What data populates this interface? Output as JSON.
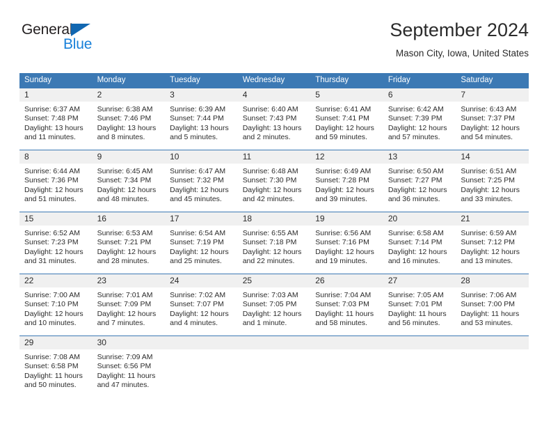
{
  "brand": {
    "name_top": "General",
    "name_bottom": "Blue",
    "triangle_color": "#1167b1",
    "blue_text_color": "#1880d9"
  },
  "header": {
    "title": "September 2024",
    "subtitle": "Mason City, Iowa, United States"
  },
  "theme": {
    "header_blue": "#3c79b4",
    "daynum_band": "#f0f0f0",
    "text": "#2b2b2b"
  },
  "calendar": {
    "weekday_headers": [
      "Sunday",
      "Monday",
      "Tuesday",
      "Wednesday",
      "Thursday",
      "Friday",
      "Saturday"
    ],
    "labels": {
      "sunrise": "Sunrise:",
      "sunset": "Sunset:",
      "daylight": "Daylight:"
    },
    "weeks": [
      [
        {
          "day": "1",
          "sunrise": "Sunrise: 6:37 AM",
          "sunset": "Sunset: 7:48 PM",
          "daylight_1": "Daylight: 13 hours",
          "daylight_2": "and 11 minutes."
        },
        {
          "day": "2",
          "sunrise": "Sunrise: 6:38 AM",
          "sunset": "Sunset: 7:46 PM",
          "daylight_1": "Daylight: 13 hours",
          "daylight_2": "and 8 minutes."
        },
        {
          "day": "3",
          "sunrise": "Sunrise: 6:39 AM",
          "sunset": "Sunset: 7:44 PM",
          "daylight_1": "Daylight: 13 hours",
          "daylight_2": "and 5 minutes."
        },
        {
          "day": "4",
          "sunrise": "Sunrise: 6:40 AM",
          "sunset": "Sunset: 7:43 PM",
          "daylight_1": "Daylight: 13 hours",
          "daylight_2": "and 2 minutes."
        },
        {
          "day": "5",
          "sunrise": "Sunrise: 6:41 AM",
          "sunset": "Sunset: 7:41 PM",
          "daylight_1": "Daylight: 12 hours",
          "daylight_2": "and 59 minutes."
        },
        {
          "day": "6",
          "sunrise": "Sunrise: 6:42 AM",
          "sunset": "Sunset: 7:39 PM",
          "daylight_1": "Daylight: 12 hours",
          "daylight_2": "and 57 minutes."
        },
        {
          "day": "7",
          "sunrise": "Sunrise: 6:43 AM",
          "sunset": "Sunset: 7:37 PM",
          "daylight_1": "Daylight: 12 hours",
          "daylight_2": "and 54 minutes."
        }
      ],
      [
        {
          "day": "8",
          "sunrise": "Sunrise: 6:44 AM",
          "sunset": "Sunset: 7:36 PM",
          "daylight_1": "Daylight: 12 hours",
          "daylight_2": "and 51 minutes."
        },
        {
          "day": "9",
          "sunrise": "Sunrise: 6:45 AM",
          "sunset": "Sunset: 7:34 PM",
          "daylight_1": "Daylight: 12 hours",
          "daylight_2": "and 48 minutes."
        },
        {
          "day": "10",
          "sunrise": "Sunrise: 6:47 AM",
          "sunset": "Sunset: 7:32 PM",
          "daylight_1": "Daylight: 12 hours",
          "daylight_2": "and 45 minutes."
        },
        {
          "day": "11",
          "sunrise": "Sunrise: 6:48 AM",
          "sunset": "Sunset: 7:30 PM",
          "daylight_1": "Daylight: 12 hours",
          "daylight_2": "and 42 minutes."
        },
        {
          "day": "12",
          "sunrise": "Sunrise: 6:49 AM",
          "sunset": "Sunset: 7:28 PM",
          "daylight_1": "Daylight: 12 hours",
          "daylight_2": "and 39 minutes."
        },
        {
          "day": "13",
          "sunrise": "Sunrise: 6:50 AM",
          "sunset": "Sunset: 7:27 PM",
          "daylight_1": "Daylight: 12 hours",
          "daylight_2": "and 36 minutes."
        },
        {
          "day": "14",
          "sunrise": "Sunrise: 6:51 AM",
          "sunset": "Sunset: 7:25 PM",
          "daylight_1": "Daylight: 12 hours",
          "daylight_2": "and 33 minutes."
        }
      ],
      [
        {
          "day": "15",
          "sunrise": "Sunrise: 6:52 AM",
          "sunset": "Sunset: 7:23 PM",
          "daylight_1": "Daylight: 12 hours",
          "daylight_2": "and 31 minutes."
        },
        {
          "day": "16",
          "sunrise": "Sunrise: 6:53 AM",
          "sunset": "Sunset: 7:21 PM",
          "daylight_1": "Daylight: 12 hours",
          "daylight_2": "and 28 minutes."
        },
        {
          "day": "17",
          "sunrise": "Sunrise: 6:54 AM",
          "sunset": "Sunset: 7:19 PM",
          "daylight_1": "Daylight: 12 hours",
          "daylight_2": "and 25 minutes."
        },
        {
          "day": "18",
          "sunrise": "Sunrise: 6:55 AM",
          "sunset": "Sunset: 7:18 PM",
          "daylight_1": "Daylight: 12 hours",
          "daylight_2": "and 22 minutes."
        },
        {
          "day": "19",
          "sunrise": "Sunrise: 6:56 AM",
          "sunset": "Sunset: 7:16 PM",
          "daylight_1": "Daylight: 12 hours",
          "daylight_2": "and 19 minutes."
        },
        {
          "day": "20",
          "sunrise": "Sunrise: 6:58 AM",
          "sunset": "Sunset: 7:14 PM",
          "daylight_1": "Daylight: 12 hours",
          "daylight_2": "and 16 minutes."
        },
        {
          "day": "21",
          "sunrise": "Sunrise: 6:59 AM",
          "sunset": "Sunset: 7:12 PM",
          "daylight_1": "Daylight: 12 hours",
          "daylight_2": "and 13 minutes."
        }
      ],
      [
        {
          "day": "22",
          "sunrise": "Sunrise: 7:00 AM",
          "sunset": "Sunset: 7:10 PM",
          "daylight_1": "Daylight: 12 hours",
          "daylight_2": "and 10 minutes."
        },
        {
          "day": "23",
          "sunrise": "Sunrise: 7:01 AM",
          "sunset": "Sunset: 7:09 PM",
          "daylight_1": "Daylight: 12 hours",
          "daylight_2": "and 7 minutes."
        },
        {
          "day": "24",
          "sunrise": "Sunrise: 7:02 AM",
          "sunset": "Sunset: 7:07 PM",
          "daylight_1": "Daylight: 12 hours",
          "daylight_2": "and 4 minutes."
        },
        {
          "day": "25",
          "sunrise": "Sunrise: 7:03 AM",
          "sunset": "Sunset: 7:05 PM",
          "daylight_1": "Daylight: 12 hours",
          "daylight_2": "and 1 minute."
        },
        {
          "day": "26",
          "sunrise": "Sunrise: 7:04 AM",
          "sunset": "Sunset: 7:03 PM",
          "daylight_1": "Daylight: 11 hours",
          "daylight_2": "and 58 minutes."
        },
        {
          "day": "27",
          "sunrise": "Sunrise: 7:05 AM",
          "sunset": "Sunset: 7:01 PM",
          "daylight_1": "Daylight: 11 hours",
          "daylight_2": "and 56 minutes."
        },
        {
          "day": "28",
          "sunrise": "Sunrise: 7:06 AM",
          "sunset": "Sunset: 7:00 PM",
          "daylight_1": "Daylight: 11 hours",
          "daylight_2": "and 53 minutes."
        }
      ],
      [
        {
          "day": "29",
          "sunrise": "Sunrise: 7:08 AM",
          "sunset": "Sunset: 6:58 PM",
          "daylight_1": "Daylight: 11 hours",
          "daylight_2": "and 50 minutes."
        },
        {
          "day": "30",
          "sunrise": "Sunrise: 7:09 AM",
          "sunset": "Sunset: 6:56 PM",
          "daylight_1": "Daylight: 11 hours",
          "daylight_2": "and 47 minutes."
        },
        {
          "day": "",
          "sunrise": "",
          "sunset": "",
          "daylight_1": "",
          "daylight_2": ""
        },
        {
          "day": "",
          "sunrise": "",
          "sunset": "",
          "daylight_1": "",
          "daylight_2": ""
        },
        {
          "day": "",
          "sunrise": "",
          "sunset": "",
          "daylight_1": "",
          "daylight_2": ""
        },
        {
          "day": "",
          "sunrise": "",
          "sunset": "",
          "daylight_1": "",
          "daylight_2": ""
        },
        {
          "day": "",
          "sunrise": "",
          "sunset": "",
          "daylight_1": "",
          "daylight_2": ""
        }
      ]
    ]
  }
}
